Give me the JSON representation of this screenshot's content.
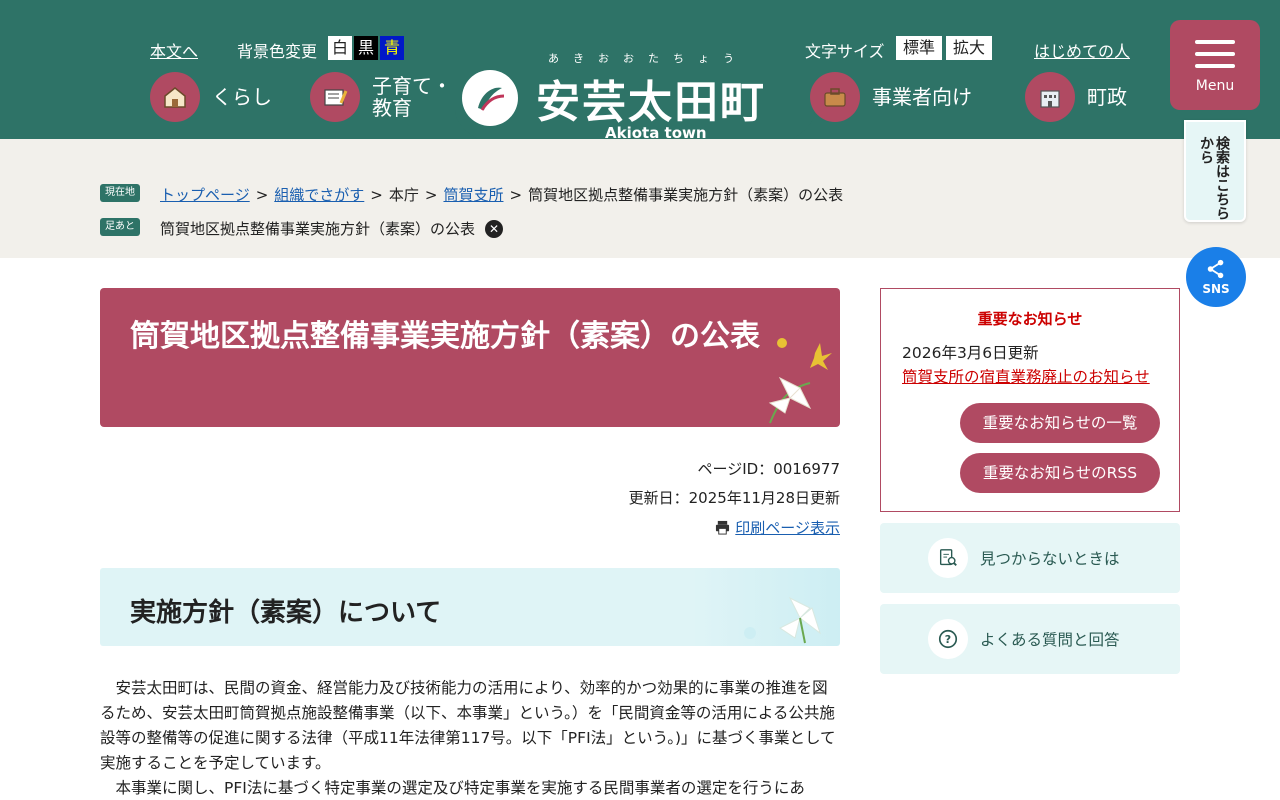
{
  "header": {
    "skip_link": "本文へ",
    "bg_label": "背景色変更",
    "bg_white": "白",
    "bg_black": "黒",
    "bg_blue": "青",
    "font_size_label": "文字サイズ",
    "font_standard": "標準",
    "font_large": "拡大",
    "first_time_link": "はじめての人",
    "logo_ruby": "あきおおたちょう",
    "logo_text": "安芸太田町",
    "logo_sub": "Akiota town",
    "nav": [
      {
        "label": "くらし"
      },
      {
        "label": "子育て・教育"
      },
      {
        "label": "事業者向け"
      },
      {
        "label": "町政"
      }
    ],
    "menu_label": "Menu",
    "search_tab": "検索はこちらから",
    "sns_label": "SNS"
  },
  "breadcrumb": {
    "current_tag": "現在地",
    "footprint_tag": "足あと",
    "items": [
      "トップページ",
      "組織でさがす",
      "本庁",
      "筒賀支所",
      "筒賀地区拠点整備事業実施方針（素案）の公表"
    ],
    "footprint_item": "筒賀地区拠点整備事業実施方針（素案）の公表"
  },
  "main": {
    "title": "筒賀地区拠点整備事業実施方針（素案）の公表",
    "page_id": "ページID：0016977",
    "updated": "更新日：2025年11月28日更新",
    "print_link": "印刷ページ表示",
    "section_heading": "実施方針（素案）について",
    "paragraph1": "安芸太田町は、民間の資金、経営能力及び技術能力の活用により、効率的かつ効果的に事業の推進を図るため、安芸太田町筒賀拠点施設整備事業（以下、本事業」という。）を「民間資金等の活用による公共施設等の整備等の促進に関する法律（平成11年法律第117号。以下「PFI法」という。)」に基づく事業として実施することを予定しています。",
    "paragraph2": "本事業に関し、PFI法に基づく特定事業の選定及び特定事業を実施する民間事業者の選定を行うにあ"
  },
  "sidebar": {
    "notice_title": "重要なお知らせ",
    "notice_date": "2026年3月6日更新",
    "notice_link": "筒賀支所の宿直業務廃止のお知らせ",
    "list_button": "重要なお知らせの一覧",
    "rss_button": "重要なお知らせのRSS",
    "not_found": "見つからないときは",
    "faq": "よくある質問と回答"
  },
  "colors": {
    "header_green": "#2e7367",
    "accent_rose": "#b04a62",
    "light_teal": "#e6f6f6",
    "sns_blue": "#1a7fe8"
  }
}
